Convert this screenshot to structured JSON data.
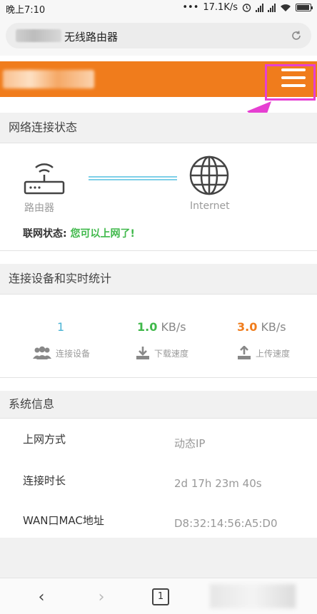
{
  "status_bar": {
    "time": "晚上7:10",
    "dots": "•••",
    "speed": "17.1K/s"
  },
  "url_bar": {
    "title": "无线路由器"
  },
  "header": {
    "menu_icon": "hamburger-menu-icon",
    "highlight_color": "#e63fd2",
    "brand_color": "#f07c1c"
  },
  "network": {
    "section_title": "网络连接状态",
    "router_label": "路由器",
    "internet_label": "Internet",
    "status_label": "联网状态:",
    "status_value": "您可以上网了!"
  },
  "devices": {
    "section_title": "连接设备和实时统计",
    "connected_count": "1",
    "connected_label": "连接设备",
    "download_value": "1.0",
    "download_unit": "KB/s",
    "download_label": "下载速度",
    "upload_value": "3.0",
    "upload_unit": "KB/s",
    "upload_label": "上传速度"
  },
  "system": {
    "section_title": "系统信息",
    "rows": [
      {
        "label": "上网方式",
        "value": "动态IP"
      },
      {
        "label": "连接时长",
        "value": "2d 17h 23m 40s"
      },
      {
        "label": "WAN口MAC地址",
        "value": "D8:32:14:56:A5:D0"
      }
    ]
  },
  "bottom_nav": {
    "back": "‹",
    "forward": "›",
    "tab_count": "1"
  }
}
